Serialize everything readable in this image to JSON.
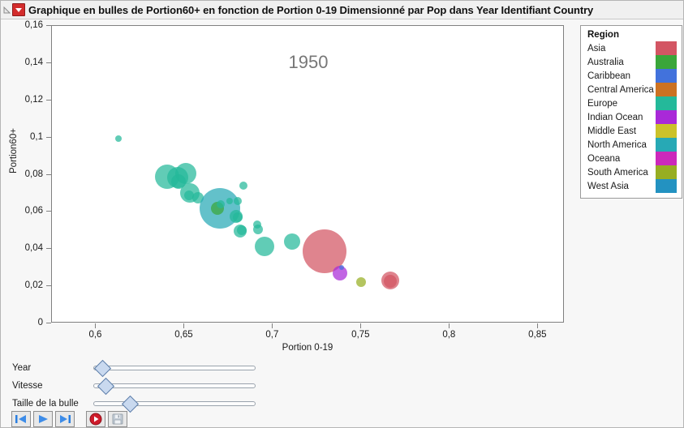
{
  "window": {
    "title": "Graphique en bulles de Portion60+ en fonction de Portion 0-19 Dimensionné par Pop dans Year Identifiant Country",
    "disclosure_icon": "triangle-collapse-icon",
    "menu_icon": "red-dropdown-icon"
  },
  "chart_data": {
    "type": "scatter",
    "title": "Graphique en bulles de Portion60+ en fonction de Portion 0-19 Dimensionné par Pop dans Year Identifiant Country",
    "annotation": "1950",
    "xlabel": "Portion 0-19",
    "ylabel": "Portion60+",
    "xlim": [
      0.575,
      0.865
    ],
    "ylim": [
      0,
      0.16
    ],
    "grid": false,
    "legend_position": "right",
    "xticks": [
      "0,6",
      "0,65",
      "0,7",
      "0,75",
      "0,8",
      "0,85"
    ],
    "xtick_values": [
      0.6,
      0.65,
      0.7,
      0.75,
      0.8,
      0.85
    ],
    "yticks": [
      "0",
      "0,02",
      "0,04",
      "0,06",
      "0,08",
      "0,1",
      "0,12",
      "0,14",
      "0,16"
    ],
    "ytick_values": [
      0,
      0.02,
      0.04,
      0.06,
      0.08,
      0.1,
      0.12,
      0.14,
      0.16
    ],
    "size_variable": "Pop",
    "color_variable": "Region",
    "points": [
      {
        "x": 0.6125,
        "y": 0.0995,
        "r": 4,
        "region": "Europe"
      },
      {
        "x": 0.64,
        "y": 0.079,
        "r": 15,
        "region": "Europe"
      },
      {
        "x": 0.646,
        "y": 0.0785,
        "r": 13,
        "region": "Europe"
      },
      {
        "x": 0.6505,
        "y": 0.0805,
        "r": 13,
        "region": "Europe"
      },
      {
        "x": 0.6465,
        "y": 0.0765,
        "r": 9,
        "region": "Europe"
      },
      {
        "x": 0.653,
        "y": 0.07,
        "r": 12,
        "region": "Europe"
      },
      {
        "x": 0.6525,
        "y": 0.069,
        "r": 6,
        "region": "Europe"
      },
      {
        "x": 0.6575,
        "y": 0.0675,
        "r": 7,
        "region": "Europe"
      },
      {
        "x": 0.67,
        "y": 0.062,
        "r": 25,
        "region": "North America"
      },
      {
        "x": 0.6685,
        "y": 0.062,
        "r": 8,
        "region": "Australia"
      },
      {
        "x": 0.6705,
        "y": 0.064,
        "r": 5,
        "region": "Europe"
      },
      {
        "x": 0.6755,
        "y": 0.066,
        "r": 4,
        "region": "Europe"
      },
      {
        "x": 0.68,
        "y": 0.066,
        "r": 5,
        "region": "Europe"
      },
      {
        "x": 0.679,
        "y": 0.0575,
        "r": 8,
        "region": "Europe"
      },
      {
        "x": 0.68,
        "y": 0.057,
        "r": 6,
        "region": "Europe"
      },
      {
        "x": 0.6835,
        "y": 0.074,
        "r": 5,
        "region": "Europe"
      },
      {
        "x": 0.6815,
        "y": 0.0495,
        "r": 8,
        "region": "Europe"
      },
      {
        "x": 0.6825,
        "y": 0.05,
        "r": 6,
        "region": "Europe"
      },
      {
        "x": 0.691,
        "y": 0.053,
        "r": 5,
        "region": "Europe"
      },
      {
        "x": 0.6915,
        "y": 0.0505,
        "r": 6,
        "region": "Europe"
      },
      {
        "x": 0.695,
        "y": 0.0415,
        "r": 12,
        "region": "Europe"
      },
      {
        "x": 0.711,
        "y": 0.044,
        "r": 10,
        "region": "Europe"
      },
      {
        "x": 0.729,
        "y": 0.039,
        "r": 27,
        "region": "Asia"
      },
      {
        "x": 0.738,
        "y": 0.027,
        "r": 9,
        "region": "Indian Ocean"
      },
      {
        "x": 0.739,
        "y": 0.03,
        "r": 3,
        "region": "Caribbean"
      },
      {
        "x": 0.75,
        "y": 0.0222,
        "r": 6,
        "region": "South America"
      },
      {
        "x": 0.7665,
        "y": 0.023,
        "r": 11,
        "region": "Asia"
      },
      {
        "x": 0.7665,
        "y": 0.0228,
        "r": 8,
        "region": "Asia"
      }
    ]
  },
  "legend": {
    "title": "Region",
    "items": [
      {
        "label": "Asia",
        "color": "#d35563"
      },
      {
        "label": "Australia",
        "color": "#3aa63a"
      },
      {
        "label": "Caribbean",
        "color": "#4272dc"
      },
      {
        "label": "Central America",
        "color": "#cc7222"
      },
      {
        "label": "Europe",
        "color": "#24b99a"
      },
      {
        "label": "Indian Ocean",
        "color": "#a929d8"
      },
      {
        "label": "Middle East",
        "color": "#cbc22a"
      },
      {
        "label": "North America",
        "color": "#27a9b5"
      },
      {
        "label": "Oceana",
        "color": "#cc29bb"
      },
      {
        "label": "South America",
        "color": "#97ae22"
      },
      {
        "label": "West Asia",
        "color": "#2392c1"
      }
    ]
  },
  "sliders": [
    {
      "label": "Year",
      "value_pct": 2,
      "name": "year-slider"
    },
    {
      "label": "Vitesse",
      "value_pct": 4,
      "name": "speed-slider"
    },
    {
      "label": "Taille de la bulle",
      "value_pct": 20,
      "name": "bubble-size-slider"
    }
  ],
  "buttons": [
    {
      "name": "step-back-button",
      "icon": "step-backward-icon"
    },
    {
      "name": "play-button",
      "icon": "play-icon"
    },
    {
      "name": "step-forward-button",
      "icon": "step-forward-icon"
    },
    {
      "name": "record-button",
      "icon": "record-icon"
    },
    {
      "name": "save-button",
      "icon": "floppy-disk-icon"
    }
  ]
}
